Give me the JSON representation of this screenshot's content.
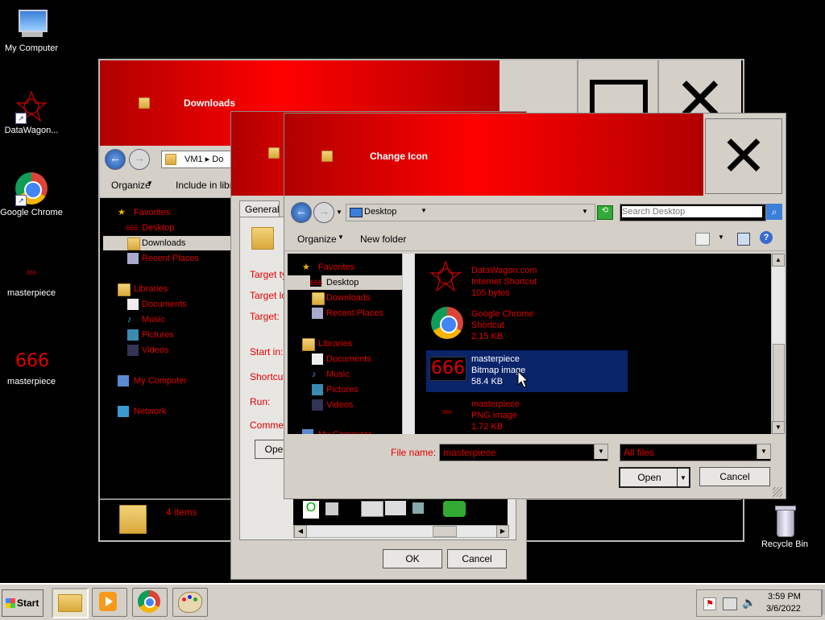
{
  "desktop": {
    "icons": [
      {
        "label": "My Computer"
      },
      {
        "label": "DataWagon..."
      },
      {
        "label": "Google Chrome"
      },
      {
        "label": "masterpiece",
        "glyph": "666"
      },
      {
        "label": "masterpiece",
        "glyph": "666"
      },
      {
        "label": "Recycle Bin"
      }
    ]
  },
  "explorer_window": {
    "title": "Downloads",
    "address": "VM1 ▸ Do",
    "toolbar": {
      "organize": "Organize",
      "include": "Include in libra"
    },
    "nav": {
      "favorites": "Favorites",
      "desktop": "Desktop",
      "desktop_glyph": "666",
      "downloads": "Downloads",
      "recent": "Recent Places",
      "libraries": "Libraries",
      "documents": "Documents",
      "music": "Music",
      "pictures": "Pictures",
      "videos": "Videos",
      "computer": "My Computer",
      "network": "Network"
    },
    "status": "4 items"
  },
  "properties_window": {
    "tab": "General",
    "labels": [
      "Target ty",
      "Target lo",
      "Target:",
      "Start in:",
      "Shortcut",
      "Run:",
      "Commen"
    ],
    "open_button": "Ope",
    "ok": "OK",
    "cancel": "Cancel"
  },
  "change_icon_dialog": {
    "title": "Change Icon",
    "address": "Desktop",
    "search_placeholder": "Search Desktop",
    "toolbar": {
      "organize": "Organize",
      "new_folder": "New folder"
    },
    "nav": {
      "favorites": "Favorites",
      "desktop": "Desktop",
      "desktop_glyph": "666",
      "downloads": "Downloads",
      "recent": "Recent Places",
      "libraries": "Libraries",
      "documents": "Documents",
      "music": "Music",
      "pictures": "Pictures",
      "videos": "Videos",
      "computer": "My Computer"
    },
    "files": [
      {
        "name": "DataWagon.com",
        "type": "Internet Shortcut",
        "size": "105 bytes"
      },
      {
        "name": "Google Chrome",
        "type": "Shortcut",
        "size": "2.15 KB"
      },
      {
        "name": "masterpiece",
        "type": "Bitmap image",
        "size": "58.4 KB",
        "glyph": "666"
      },
      {
        "name": "masterpiece",
        "type": "PNG image",
        "size": "1.72 KB",
        "glyph": "666"
      }
    ],
    "filename_label": "File name:",
    "filename_value": "masterpiece",
    "filter_value": "All files",
    "open": "Open",
    "cancel": "Cancel"
  },
  "taskbar": {
    "start": "Start",
    "time": "3:59 PM",
    "date": "3/6/2022"
  },
  "colors": {
    "accent_red": "#e00000",
    "title_red": "#ff0000",
    "selection": "#0a246a"
  }
}
